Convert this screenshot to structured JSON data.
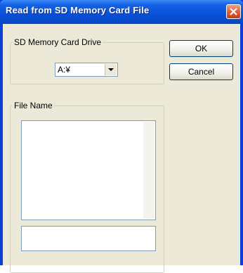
{
  "window": {
    "title": "Read from SD Memory Card File"
  },
  "drive_group": {
    "label": "SD Memory Card Drive",
    "selected_drive": "A:¥"
  },
  "file_group": {
    "label": "File Name",
    "file_list": [],
    "file_name_value": ""
  },
  "buttons": {
    "ok": "OK",
    "cancel": "Cancel"
  },
  "icons": {
    "close": "close-icon",
    "dropdown": "chevron-down-icon"
  },
  "colors": {
    "titlebar": "#0850d8",
    "dialog_bg": "#ece9d8",
    "close_button": "#e06040"
  }
}
